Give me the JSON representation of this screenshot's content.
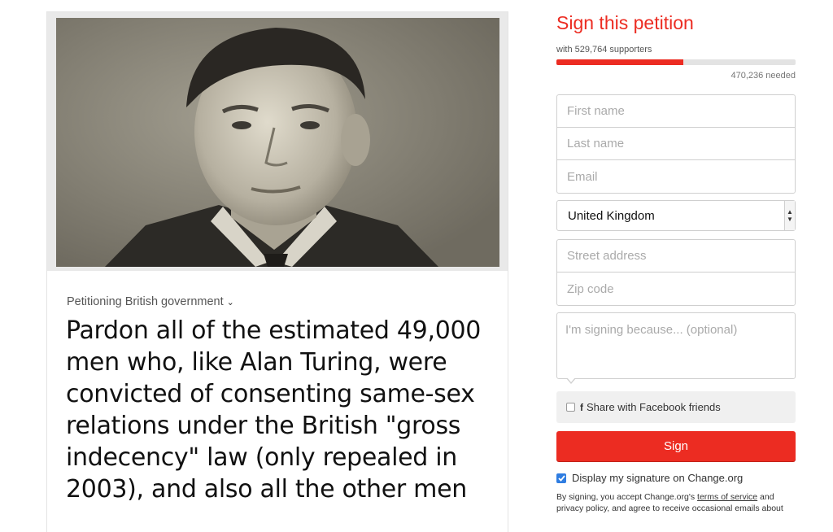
{
  "petition": {
    "petitioning_label": "Petitioning British government",
    "headline": "Pardon all of the estimated 49,000 men who, like Alan Turing, were convicted of consenting same-sex relations under the British \"gross indecency\" law (only repealed in 2003), and also all the other men"
  },
  "sign": {
    "title": "Sign this petition",
    "supporters_text": "with 529,764 supporters",
    "progress_fraction": 0.53,
    "needed_text": "470,236 needed",
    "first_name_placeholder": "First name",
    "last_name_placeholder": "Last name",
    "email_placeholder": "Email",
    "country_value": "United Kingdom",
    "street_placeholder": "Street address",
    "zip_placeholder": "Zip code",
    "reason_placeholder": "I'm signing because... (optional)",
    "facebook_share_label": "Share with Facebook friends",
    "sign_button_label": "Sign",
    "display_signature_label": "Display my signature on Change.org",
    "terms_prefix": "By signing, you accept Change.org's ",
    "terms_link": "terms of service",
    "terms_middle": " and",
    "terms_line2": "privacy policy, and agree to receive occasional emails about"
  },
  "colors": {
    "accent": "#ec2c22",
    "checkbox_checked": "#2f7de1"
  }
}
